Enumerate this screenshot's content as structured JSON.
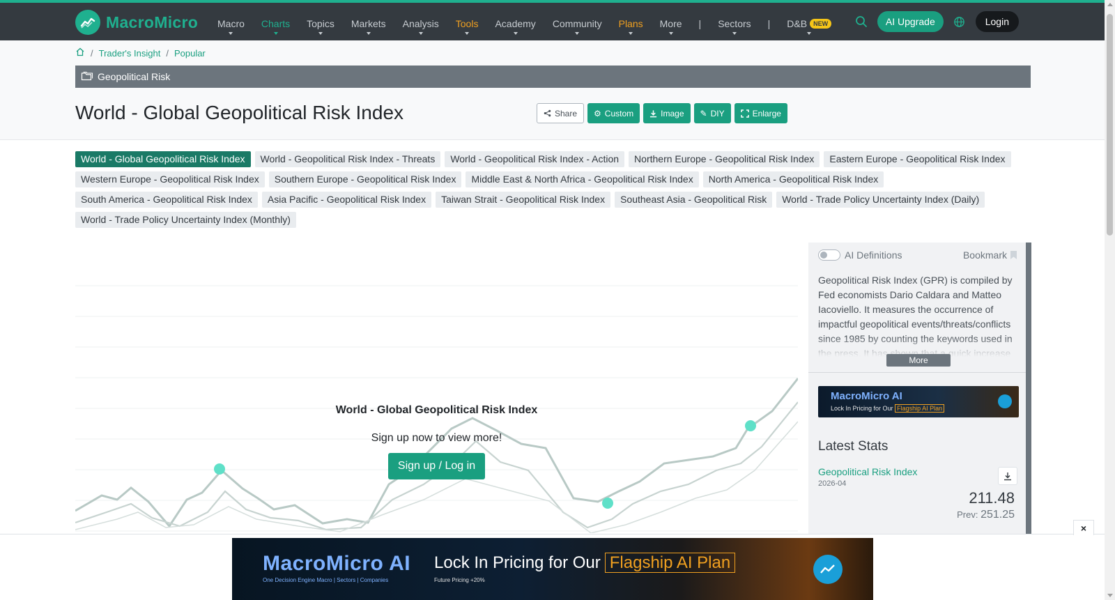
{
  "brand": {
    "name": "MacroMicro"
  },
  "nav": {
    "items": [
      {
        "label": "Macro"
      },
      {
        "label": "Charts"
      },
      {
        "label": "Topics"
      },
      {
        "label": "Markets"
      },
      {
        "label": "Analysis"
      },
      {
        "label": "Tools"
      },
      {
        "label": "Academy"
      },
      {
        "label": "Community"
      },
      {
        "label": "Plans"
      },
      {
        "label": "More"
      },
      {
        "label": "Sectors"
      },
      {
        "label": "D&B",
        "badge": "NEW"
      }
    ],
    "separator": "|",
    "ai_upgrade": "AI Upgrade",
    "login": "Login",
    "icons": [
      "search-icon",
      "globe-icon"
    ]
  },
  "breadcrumb": {
    "items": [
      "Trader's Insight",
      "Popular"
    ],
    "separator": "/"
  },
  "category": {
    "label": "Geopolitical Risk"
  },
  "page": {
    "title": "World - Global Geopolitical Risk Index"
  },
  "tags": [
    "World - Global Geopolitical Risk Index",
    "World - Geopolitical Risk Index - Threats",
    "World - Geopolitical Risk Index - Action",
    "Northern Europe - Geopolitical Risk Index",
    "Eastern Europe - Geopolitical Risk Index",
    "Western Europe - Geopolitical Risk Index",
    "Southern Europe - Geopolitical Risk Index",
    "Middle East & North Africa - Geopolitical Risk Index",
    "North America - Geopolitical Risk Index",
    "South America - Geopolitical Risk Index",
    "Asia Pacific - Geopolitical Risk Index",
    "Taiwan Strait - Geopolitical Risk Index",
    "Southeast Asia - Geopolitical Risk",
    "World - Trade Policy Uncertainty Index (Daily)",
    "World - Trade Policy Uncertainty Index (Monthly)"
  ],
  "toolbar": {
    "share": "Share",
    "custom": "Custom",
    "image": "Image",
    "diy": "DIY",
    "enlarge": "Enlarge"
  },
  "overlay": {
    "title": "World - Global Geopolitical Risk Index",
    "subtitle": "Sign up now to view more!",
    "button": "Sign up / Log in"
  },
  "sidebar": {
    "ai_definitions": "AI Definitions",
    "bookmark": "Bookmark",
    "description": "Geopolitical Risk Index (GPR) is compiled by Fed economists Dario Caldara and Matteo Iacoviello. It measures the occurrence of impactful geopolitical events/threats/conflicts since 1985 by counting the keywords used in the press. It has shown that a quick increase",
    "more": "More",
    "banner": {
      "brand": "MacroMicro AI",
      "text": "Lock In Pricing for Our",
      "plan": "Flagship AI Plan"
    },
    "latest_stats_title": "Latest Stats",
    "stat": {
      "name": "Geopolitical Risk Index",
      "date": "2026-04",
      "value": "211.48",
      "prev_label": "Prev:",
      "prev_value": "251.25"
    }
  },
  "ad": {
    "close": "×",
    "brand": "MacroMicro AI",
    "tagline": "One Decision Engine  Macro | Sectors | Companies",
    "headline": "Lock In Pricing for Our",
    "plan": "Flagship AI Plan",
    "sub": "Future Pricing +20%"
  },
  "colors": {
    "accent": "#1a9f80",
    "topbar": "#343a40",
    "warning": "#f0a020",
    "chart_line": "#b8c9c5",
    "chart_marker": "#5fe0c8"
  },
  "chart_data": {
    "type": "line",
    "title": "World - Global Geopolitical Risk Index",
    "note": "chart blurred behind sign-up overlay; values not readable",
    "series": []
  }
}
